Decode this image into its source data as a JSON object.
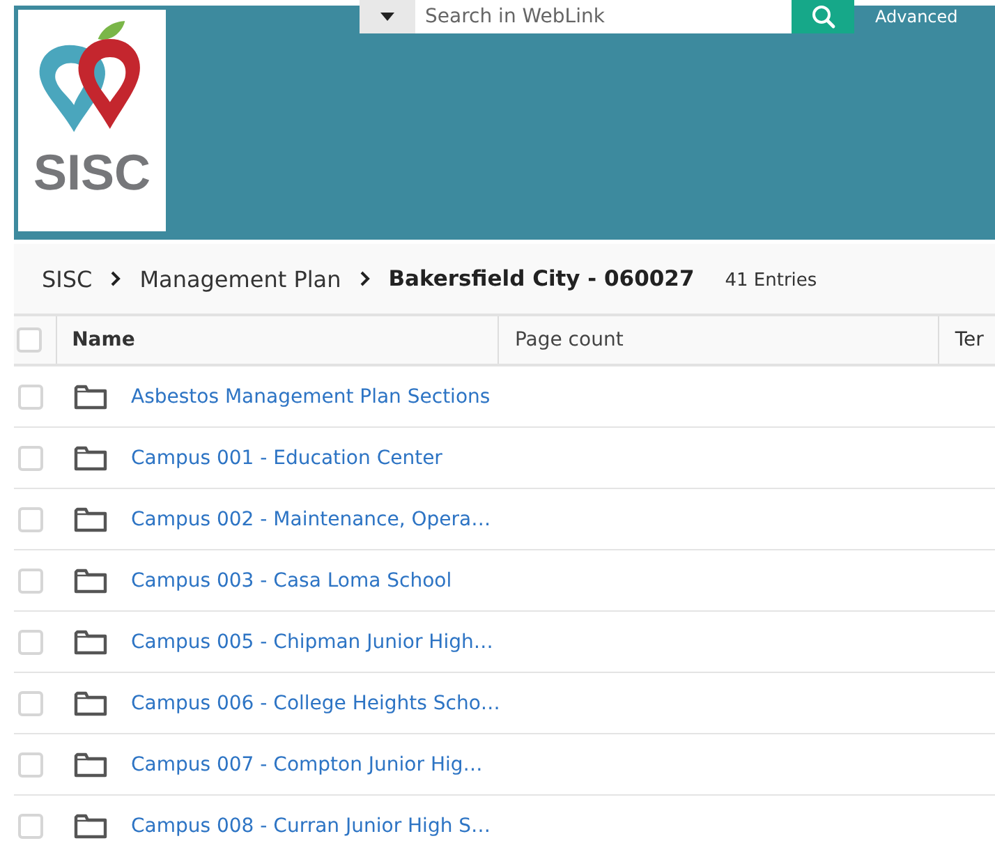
{
  "header": {
    "logo_text": "SISC",
    "search": {
      "placeholder": "Search in WebLink"
    },
    "advanced_link": "Advanced"
  },
  "breadcrumb": {
    "items": [
      "SISC",
      "Management Plan",
      "Bakersfield City - 060027"
    ],
    "count": "41 Entries"
  },
  "table": {
    "select_all": {
      "checked": false
    },
    "columns": [
      "Name",
      "Page count",
      "Ter"
    ],
    "rows": [
      {
        "name": "Asbestos Management Plan Sections",
        "checked": false
      },
      {
        "name": "Campus 001 - Education Center",
        "checked": false
      },
      {
        "name": "Campus 002 - Maintenance, Opera…",
        "checked": false
      },
      {
        "name": "Campus 003 - Casa Loma School",
        "checked": false
      },
      {
        "name": "Campus 005 - Chipman Junior High…",
        "checked": false
      },
      {
        "name": "Campus 006 - College Heights Scho…",
        "checked": false
      },
      {
        "name": "Campus 007 - Compton Junior Hig…",
        "checked": false
      },
      {
        "name": "Campus 008 - Curran Junior High S…",
        "checked": false
      }
    ]
  }
}
